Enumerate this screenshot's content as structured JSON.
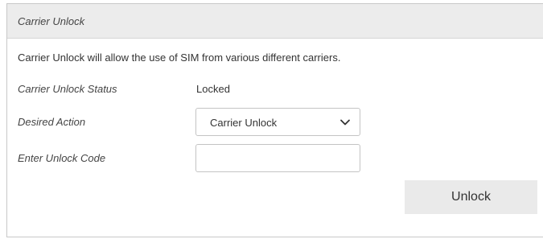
{
  "panel": {
    "title": "Carrier Unlock",
    "description": "Carrier Unlock will allow the use of SIM from various different carriers."
  },
  "status": {
    "label": "Carrier Unlock Status",
    "value": "Locked"
  },
  "desired_action": {
    "label": "Desired Action",
    "selected": "Carrier Unlock",
    "icon": "chevron-down-icon"
  },
  "unlock_code": {
    "label": "Enter Unlock Code",
    "value": "",
    "placeholder": ""
  },
  "actions": {
    "unlock_label": "Unlock"
  },
  "colors": {
    "header_background": "#ececec",
    "button_background": "#eaeaea",
    "border": "#c4c4c4"
  }
}
